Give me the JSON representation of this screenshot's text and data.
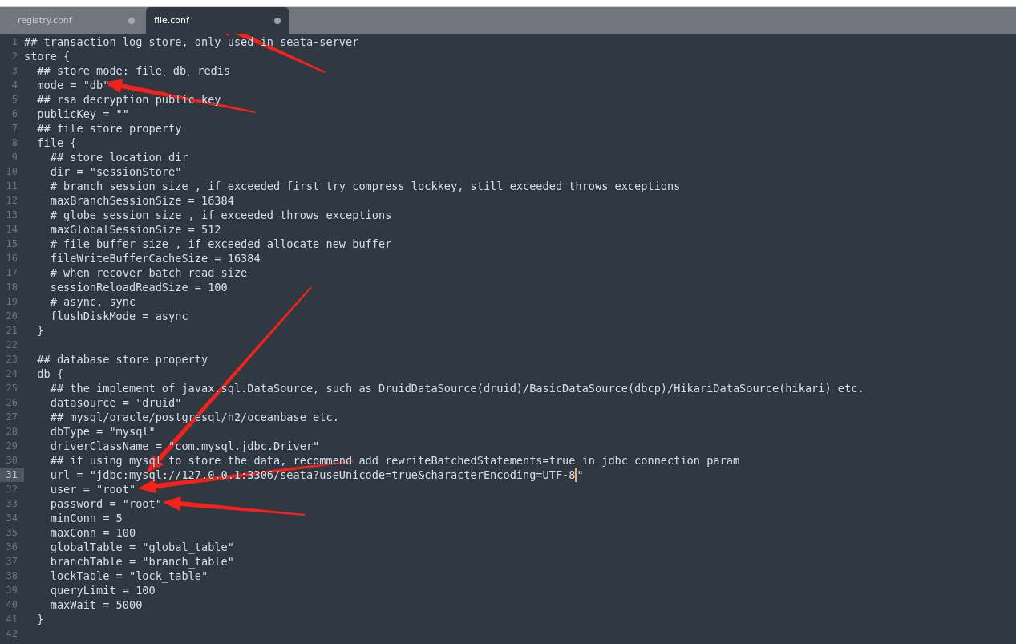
{
  "tabs": [
    {
      "label": "registry.conf",
      "selected": false
    },
    {
      "label": "file.conf",
      "selected": true
    }
  ],
  "lines": [
    {
      "number": "1",
      "text": "## transaction log store, only used in seata-server",
      "current": false
    },
    {
      "number": "2",
      "text": "store {",
      "current": false
    },
    {
      "number": "3",
      "text": "  ## store mode: file、db、redis",
      "current": false
    },
    {
      "number": "4",
      "text": "  mode = \"db\"",
      "current": false
    },
    {
      "number": "5",
      "text": "  ## rsa decryption public key",
      "current": false
    },
    {
      "number": "6",
      "text": "  publicKey = \"\"",
      "current": false
    },
    {
      "number": "7",
      "text": "  ## file store property",
      "current": false
    },
    {
      "number": "8",
      "text": "  file {",
      "current": false
    },
    {
      "number": "9",
      "text": "    ## store location dir",
      "current": false
    },
    {
      "number": "10",
      "text": "    dir = \"sessionStore\"",
      "current": false
    },
    {
      "number": "11",
      "text": "    # branch session size , if exceeded first try compress lockkey, still exceeded throws exceptions",
      "current": false
    },
    {
      "number": "12",
      "text": "    maxBranchSessionSize = 16384",
      "current": false
    },
    {
      "number": "13",
      "text": "    # globe session size , if exceeded throws exceptions",
      "current": false
    },
    {
      "number": "14",
      "text": "    maxGlobalSessionSize = 512",
      "current": false
    },
    {
      "number": "15",
      "text": "    # file buffer size , if exceeded allocate new buffer",
      "current": false
    },
    {
      "number": "16",
      "text": "    fileWriteBufferCacheSize = 16384",
      "current": false
    },
    {
      "number": "17",
      "text": "    # when recover batch read size",
      "current": false
    },
    {
      "number": "18",
      "text": "    sessionReloadReadSize = 100",
      "current": false
    },
    {
      "number": "19",
      "text": "    # async, sync",
      "current": false
    },
    {
      "number": "20",
      "text": "    flushDiskMode = async",
      "current": false
    },
    {
      "number": "21",
      "text": "  }",
      "current": false
    },
    {
      "number": "22",
      "current": false
    },
    {
      "number": "23",
      "text": "  ## database store property",
      "current": false
    },
    {
      "number": "24",
      "text": "  db {",
      "current": false
    },
    {
      "number": "25",
      "text": "    ## the implement of javax.sql.DataSource, such as DruidDataSource(druid)/BasicDataSource(dbcp)/HikariDataSource(hikari) etc.",
      "current": false
    },
    {
      "number": "26",
      "text": "    datasource = \"druid\"",
      "current": false
    },
    {
      "number": "27",
      "text": "    ## mysql/oracle/postgresql/h2/oceanbase etc.",
      "current": false
    },
    {
      "number": "28",
      "text": "    dbType = \"mysql\"",
      "current": false
    },
    {
      "number": "29",
      "text": "    driverClassName = \"com.mysql.jdbc.Driver\"",
      "current": false
    },
    {
      "number": "30",
      "text": "    ## if using mysql to store the data, recommend add rewriteBatchedStatements=true in jdbc connection param",
      "current": false
    },
    {
      "number": "31",
      "text": "    url = \"jdbc:mysql://127.0.0.1:3306/seata?useUnicode=true&characterEncoding=UTF-8",
      "after_cursor": "\"",
      "current": true
    },
    {
      "number": "32",
      "text": "    user = \"root\"",
      "current": false
    },
    {
      "number": "33",
      "text": "    password = \"root\"",
      "current": false
    },
    {
      "number": "34",
      "text": "    minConn = 5",
      "current": false
    },
    {
      "number": "35",
      "text": "    maxConn = 100",
      "current": false
    },
    {
      "number": "36",
      "text": "    globalTable = \"global_table\"",
      "current": false
    },
    {
      "number": "37",
      "text": "    branchTable = \"branch_table\"",
      "current": false
    },
    {
      "number": "38",
      "text": "    lockTable = \"lock_table\"",
      "current": false
    },
    {
      "number": "39",
      "text": "    queryLimit = 100",
      "current": false
    },
    {
      "number": "40",
      "text": "    maxWait = 5000",
      "current": false
    },
    {
      "number": "41",
      "text": "  }",
      "current": false
    },
    {
      "number": "42",
      "current": false
    }
  ]
}
